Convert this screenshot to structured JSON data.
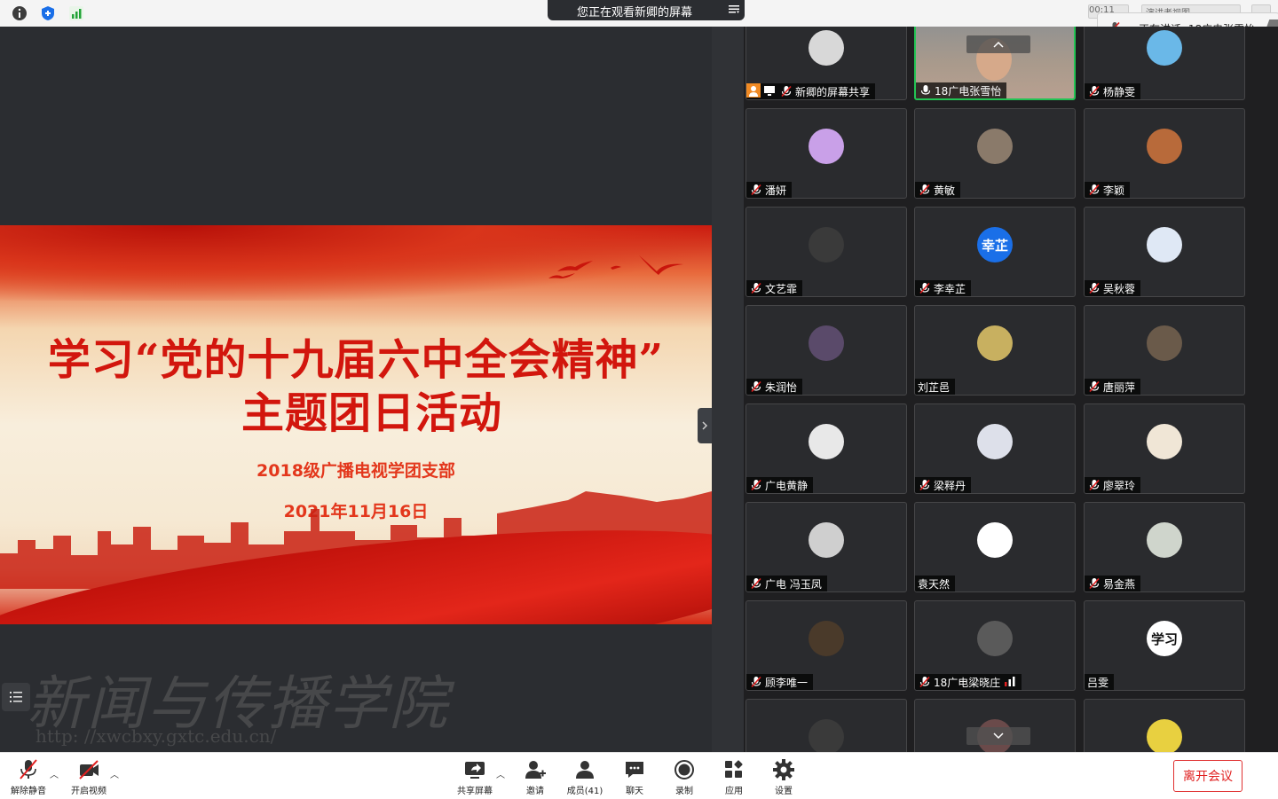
{
  "topbar": {
    "share_notice": "您正在观看新卿的屏幕",
    "speaking": "正在讲话: 18广电张雪怡;",
    "ghost_1": "00:11",
    "ghost_2": "演讲者视图"
  },
  "slide": {
    "title_line1": "学习“党的十九届六中全会精神”",
    "title_line2": "主题团日活动",
    "subtitle": "2018级广播电视学团支部",
    "date": "2021年11月16日"
  },
  "watermark": {
    "text": "新闻与传播学院",
    "url": "http: //xwcbxy.gxtc.edu.cn/"
  },
  "participants": [
    {
      "name": "新卿的屏幕共享",
      "muted": true
    },
    {
      "name": "18广电张雪怡",
      "muted": false,
      "speaking": true
    },
    {
      "name": "杨静雯",
      "muted": true
    },
    {
      "name": "潘妍",
      "muted": true
    },
    {
      "name": "黄敏",
      "muted": true
    },
    {
      "name": "李颖",
      "muted": true
    },
    {
      "name": "文艺霏",
      "muted": true
    },
    {
      "name": "李幸芷",
      "muted": true,
      "initials": "幸芷"
    },
    {
      "name": "吴秋蓉",
      "muted": true
    },
    {
      "name": "朱润怡",
      "muted": true
    },
    {
      "name": "刘芷邑",
      "muted": false
    },
    {
      "name": "唐丽萍",
      "muted": true
    },
    {
      "name": "广电黄静",
      "muted": true
    },
    {
      "name": "梁释丹",
      "muted": true
    },
    {
      "name": "廖翠玲",
      "muted": true
    },
    {
      "name": "广电 冯玉凤",
      "muted": true
    },
    {
      "name": "袁天然",
      "muted": false
    },
    {
      "name": "易金燕",
      "muted": true
    },
    {
      "name": "顾李唯一",
      "muted": true
    },
    {
      "name": "18广电梁晓庄",
      "muted": true
    },
    {
      "name": "吕雯",
      "muted": false,
      "initials": "学习"
    }
  ],
  "toolbar": {
    "unmute": "解除静音",
    "start_video": "开启视频",
    "share_screen": "共享屏幕",
    "invite": "邀请",
    "members": "成员(41)",
    "chat": "聊天",
    "record": "录制",
    "apps": "应用",
    "settings": "设置",
    "leave": "离开会议"
  },
  "colors": {
    "speaking_border": "#23c454",
    "leave_red": "#e02020",
    "slide_red": "#d2160d",
    "avatar_blue": "#1a6fe8"
  }
}
